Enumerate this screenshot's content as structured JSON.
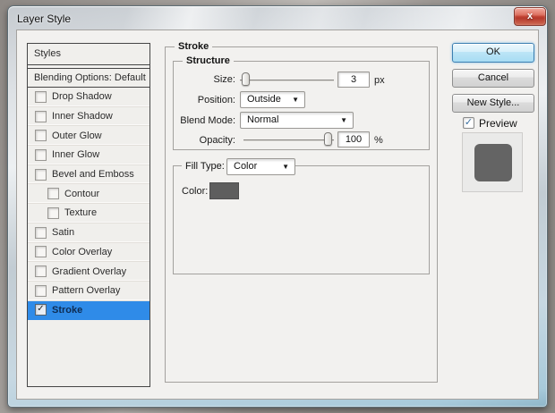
{
  "window": {
    "title": "Layer Style",
    "close_glyph": "x"
  },
  "icons": {
    "check": "✓",
    "dropdown_arrow": "▼"
  },
  "sidebar": {
    "header": "Styles",
    "blending_options": "Blending Options: Default",
    "items": [
      {
        "label": "Drop Shadow",
        "checked": false,
        "indent": false,
        "selected": false
      },
      {
        "label": "Inner Shadow",
        "checked": false,
        "indent": false,
        "selected": false
      },
      {
        "label": "Outer Glow",
        "checked": false,
        "indent": false,
        "selected": false
      },
      {
        "label": "Inner Glow",
        "checked": false,
        "indent": false,
        "selected": false
      },
      {
        "label": "Bevel and Emboss",
        "checked": false,
        "indent": false,
        "selected": false
      },
      {
        "label": "Contour",
        "checked": false,
        "indent": true,
        "selected": false
      },
      {
        "label": "Texture",
        "checked": false,
        "indent": true,
        "selected": false
      },
      {
        "label": "Satin",
        "checked": false,
        "indent": false,
        "selected": false
      },
      {
        "label": "Color Overlay",
        "checked": false,
        "indent": false,
        "selected": false
      },
      {
        "label": "Gradient Overlay",
        "checked": false,
        "indent": false,
        "selected": false
      },
      {
        "label": "Pattern Overlay",
        "checked": false,
        "indent": false,
        "selected": false
      },
      {
        "label": "Stroke",
        "checked": true,
        "indent": false,
        "selected": true
      }
    ]
  },
  "panel": {
    "group_label": "Stroke",
    "structure": {
      "legend": "Structure",
      "size_label": "Size:",
      "size_value": "3",
      "size_unit": "px",
      "position_label": "Position:",
      "position_value": "Outside",
      "blend_mode_label": "Blend Mode:",
      "blend_mode_value": "Normal",
      "opacity_label": "Opacity:",
      "opacity_value": "100",
      "opacity_unit": "%"
    },
    "fill": {
      "legend": "Fill Type:",
      "fill_type_value": "Color",
      "color_label": "Color:",
      "color_swatch": "#5e5e5e"
    }
  },
  "actions": {
    "ok": "OK",
    "cancel": "Cancel",
    "new_style": "New Style...",
    "preview_label": "Preview",
    "preview_checked": true
  },
  "preview": {
    "swatch_color": "#646464"
  },
  "colors": {
    "selection_blue": "#2f8be8",
    "dialog_bg": "#f2f1ef",
    "close_button_red": "#c24334"
  }
}
